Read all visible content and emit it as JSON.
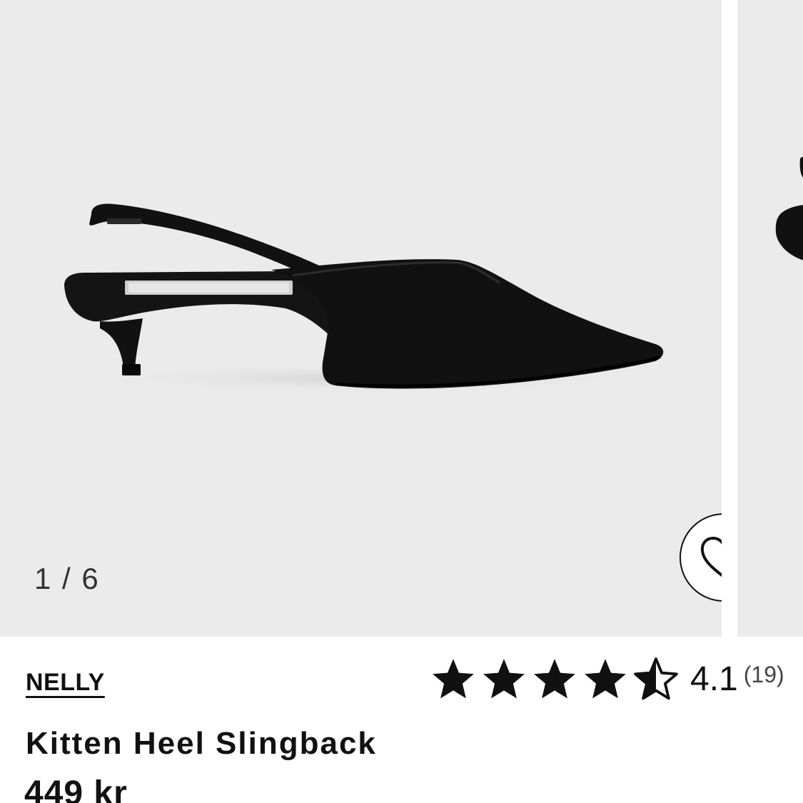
{
  "gallery": {
    "counter": "1 / 6",
    "current_image": 1,
    "total_images": 6,
    "background_color": "#ebebeb",
    "image_alt": "Black kitten heel slingback shoe",
    "favorite_icon": "heart-outline-icon"
  },
  "product": {
    "brand": "NELLY",
    "name": "Kitten Heel Slingback",
    "price": "449 kr",
    "rating": {
      "value": "4.1",
      "count": "(19)",
      "stars_value": 4.1,
      "stars_max": 5,
      "star_icon": "star-icon",
      "star_color": "#111111"
    }
  }
}
